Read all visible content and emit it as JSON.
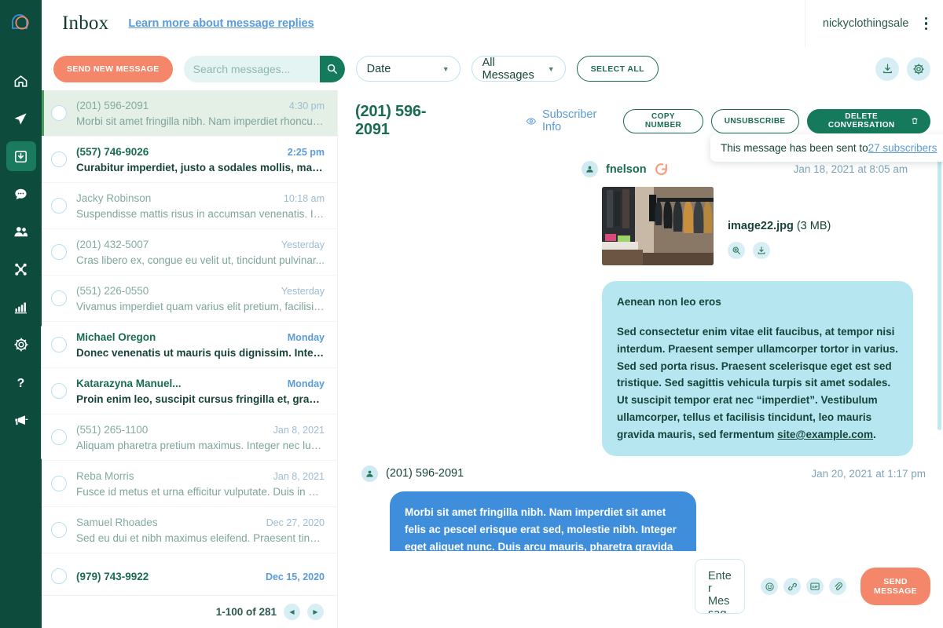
{
  "brand": {
    "logo_icon": "overlapping-arch-circle-logo",
    "accent_green": "#0d4b3c",
    "accent_teal": "#157a5b",
    "accent_coral": "#f4866a",
    "accent_blue": "#5b9bd8",
    "bubble_light": "#b6e6f0",
    "bubble_blue": "#3f8edb"
  },
  "sidebar": {
    "items": [
      {
        "name": "home-icon",
        "label": "Home"
      },
      {
        "name": "paper-plane-icon",
        "label": "Send"
      },
      {
        "name": "inbox-download-icon",
        "label": "Inbox",
        "active": true
      },
      {
        "name": "chat-bubble-icon",
        "label": "Conversations"
      },
      {
        "name": "people-icon",
        "label": "Subscribers"
      },
      {
        "name": "network-nodes-icon",
        "label": "Integrations"
      },
      {
        "name": "bar-chart-icon",
        "label": "Reports"
      },
      {
        "name": "gear-icon",
        "label": "Settings"
      },
      {
        "name": "question-mark-icon",
        "label": "Help"
      },
      {
        "name": "megaphone-icon",
        "label": "Announcements"
      }
    ]
  },
  "topbar": {
    "title": "Inbox",
    "link": "Learn more about message replies",
    "account_name": "nickyclothingsale",
    "kebab_icon": "vertical-dots-icon"
  },
  "toolbar": {
    "send_new_message": "SEND NEW MESSAGE",
    "search_placeholder": "Search messages...",
    "search_value": "",
    "search_icon": "search-icon",
    "date_filter": "Date",
    "messages_filter": "All Messages",
    "select_all": "SELECT ALL",
    "download_icon": "download-icon",
    "settings_icon": "gear-icon"
  },
  "list": {
    "items": [
      {
        "name": "(201) 596-2091",
        "time": "4:30 pm",
        "preview": "Morbi sit amet fringilla nibh. Nam imperdiet  rhoncus...",
        "unread": false,
        "selected": true
      },
      {
        "name": "(557) 746-9026",
        "time": "2:25 pm",
        "preview": "Curabitur imperdiet, justo a sodales mollis, massa...",
        "unread": true,
        "selected": false
      },
      {
        "name": "Jacky Robinson",
        "time": "10:18 am",
        "preview": "Suspendisse mattis risus in accumsan venenatis. In...",
        "unread": false,
        "selected": false
      },
      {
        "name": "(201) 432-5007",
        "time": "Yesterday",
        "preview": "Cras libero ex, congue eu velit ut, tincidunt pulvinar...",
        "unread": false,
        "selected": false
      },
      {
        "name": "(551) 226-0550",
        "time": "Yesterday",
        "preview": "Vivamus imperdiet quam varius elit pretium, facilisis...",
        "unread": false,
        "selected": false
      },
      {
        "name": "Michael Oregon",
        "time": "Monday",
        "preview": "Donec venenatis ut mauris quis dignissim. Integer...",
        "unread": true,
        "selected": false
      },
      {
        "name": "Katarazyna Manuel...",
        "time": "Monday",
        "preview": "Proin enim leo, suscipit cursus fringilla et, gravida...",
        "unread": true,
        "selected": false
      },
      {
        "name": "(551) 265-1100",
        "time": "Jan 8, 2021",
        "preview": "Aliquam pharetra pretium maximus. Integer nec luct...",
        "unread": false,
        "selected": false
      },
      {
        "name": "Reba Morris",
        "time": "Jan 8, 2021",
        "preview": "Fusce id metus et urna efficitur vulputate. Duis in di...",
        "unread": false,
        "selected": false
      },
      {
        "name": "Samuel Rhoades",
        "time": "Dec 27, 2020",
        "preview": "Sed eu dui et nibh maximus eleifend. Praesent tinci...",
        "unread": false,
        "selected": false
      },
      {
        "name": "(979) 743-9922",
        "time": "Dec 15, 2020",
        "preview": "",
        "unread": true,
        "selected": false
      }
    ],
    "pager": {
      "label": "1-100 of 281",
      "prev_icon": "chevron-left-icon",
      "next_icon": "chevron-right-icon"
    }
  },
  "conversation": {
    "phone": "(201) 596-2091",
    "subscriber_info": "Subscriber Info",
    "eye_icon": "eye-icon",
    "copy_number": "COPY NUMBER",
    "unsubscribe": "UNSUBSCRIBE",
    "delete_conversation": "DELETE CONVERSATION",
    "trash_icon": "trash-icon",
    "popover": {
      "text_before": "This message has been sent to ",
      "link": "27 subscribers"
    },
    "messages": [
      {
        "author": "fnelson",
        "author_bold": true,
        "date": "Jan 18, 2021 at 8:05 am",
        "direction": "in",
        "avatar_icon": "user-avatar-icon",
        "status_icon": "loading-spinner-icon",
        "attachment": {
          "filename": "image22.jpg",
          "size": "(3 MB)",
          "zoom_icon": "magnify-plus-icon",
          "download_icon": "download-icon",
          "thumb_alt": "clothing-rack-photo"
        },
        "bubble_title": "Aenean non leo eros",
        "bubble_text": "Sed consectetur enim vitae elit faucibus, at tempor nisi interdum. Praesent semper ullamcorper tortor in varius. Sed sed porta risus. Praesent scelerisque eget est sed tristique. Sed sagittis vehicula turpis sit amet sodales. Ut suscipit tempor erat nec “imperdiet”. Vestibulum ullamcorper, tellus et facilisis tincidunt, leo mauris gravida mauris, sed fermentum ",
        "bubble_link": "site@example.com",
        "bubble_text_after": "."
      },
      {
        "author": "(201) 596-2091",
        "author_bold": false,
        "date": "Jan 20, 2021 at 1:17 pm",
        "direction": "out",
        "avatar_icon": "user-avatar-icon",
        "bubble_text": "Morbi sit amet fringilla nibh. Nam imperdiet sit amet felis ac pescel erisque erat sed, molestie nibh. Integer eget aliquet nunc. Duis arcu mauris, pharetra gravida aliquet ut, vulputate nec nisi."
      }
    ],
    "composer": {
      "placeholder": "Enter Message Here",
      "value": "",
      "emoji_icon": "smiley-face-icon",
      "link_icon": "link-icon",
      "gif_icon": "gif-icon",
      "attach_icon": "paperclip-icon",
      "send_label": "SEND MESSAGE"
    }
  }
}
